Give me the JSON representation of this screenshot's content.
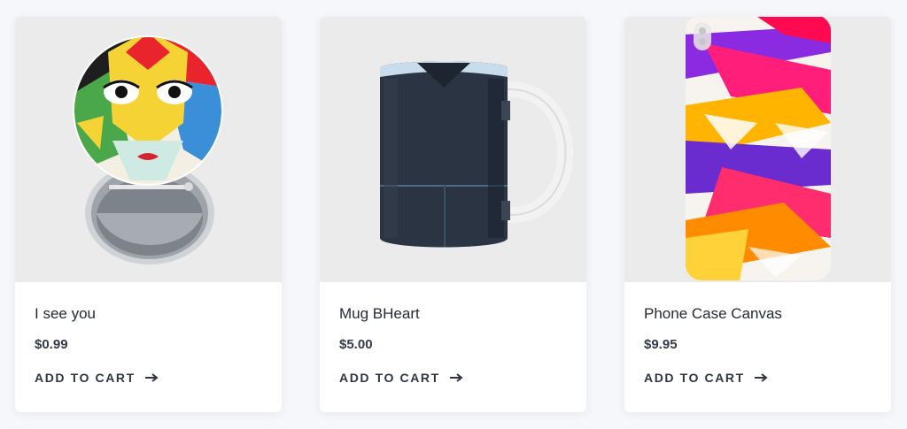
{
  "products": [
    {
      "title": "I see you",
      "price": "$0.99",
      "cta": "ADD TO CART",
      "image": "pin-button-image",
      "icon": "arrow-right-icon"
    },
    {
      "title": "Mug BHeart",
      "price": "$5.00",
      "cta": "ADD TO CART",
      "image": "mug-image",
      "icon": "arrow-right-icon"
    },
    {
      "title": "Phone Case Canvas",
      "price": "$9.95",
      "cta": "ADD TO CART",
      "image": "phone-case-image",
      "icon": "arrow-right-icon"
    }
  ],
  "colors": {
    "page_bg": "#f6f7fb",
    "card_bg": "#ffffff",
    "media_bg": "#ebebeb",
    "text": "#252a35",
    "accent": "#2f3545"
  }
}
